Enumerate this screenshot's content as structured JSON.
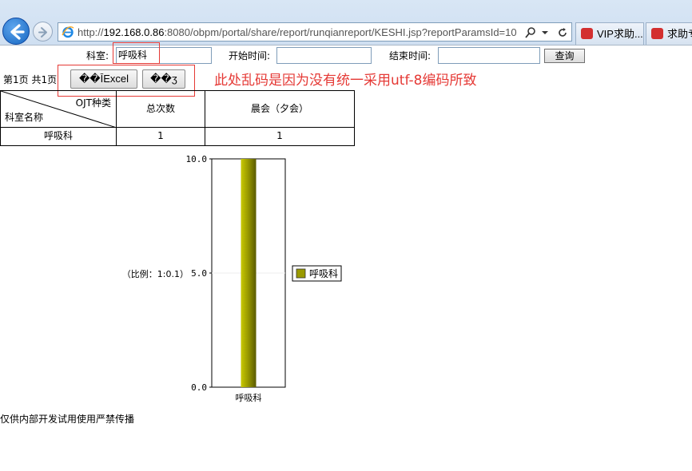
{
  "browser": {
    "url_prefix": "http://",
    "url_host": "192.168.0.86",
    "url_rest": ":8080/obpm/portal/share/report/runqianreport/KESHI.jsp?reportParamsId=10",
    "tabs": [
      {
        "label": "VIP求助..."
      },
      {
        "label": "求助专"
      }
    ]
  },
  "query": {
    "dept_label": "科室:",
    "dept_value": "呼吸科",
    "start_label": "开始时间:",
    "start_value": "",
    "end_label": "结束时间:",
    "end_value": "",
    "search_button": "查询"
  },
  "toolbar": {
    "paging": "第1页 共1页",
    "export_excel": "��ĪExcel",
    "print": "��ӡ",
    "annotation": "此处乱码是因为没有统一采用utf-8编码所致"
  },
  "table": {
    "corner_top": "OJT种类",
    "corner_bottom": "科室名称",
    "headers": [
      "总次数",
      "晨会（夕会）"
    ],
    "rows": [
      {
        "name": "呼吸科",
        "values": [
          "1",
          "1"
        ]
      }
    ]
  },
  "chart_data": {
    "type": "bar",
    "categories": [
      "呼吸科"
    ],
    "series": [
      {
        "name": "呼吸科",
        "values": [
          10.0
        ]
      }
    ],
    "ylim": [
      0,
      10
    ],
    "yticks": [
      "10.0",
      "5.0",
      "0.0"
    ],
    "ylabel": "（比例：1:0.1）",
    "legend_placement": "right",
    "bar_color": "#9a9a00"
  },
  "footer": "仅供内部开发试用使用严禁传播"
}
